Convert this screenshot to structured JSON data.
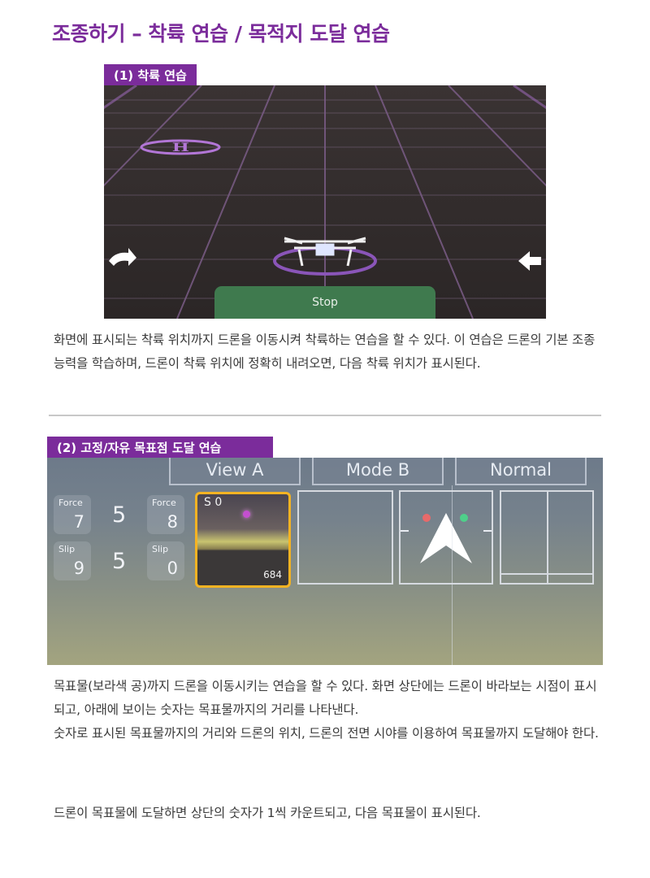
{
  "page": {
    "title": "조종하기 – 착륙 연습 / 목적지 도달 연습"
  },
  "section1": {
    "label": "(1) 착륙 연습",
    "screenshot": {
      "stop_label": "Stop",
      "icons": [
        "helipad-icon",
        "drone-icon",
        "landing-target-icon",
        "rotate-icon",
        "arrow-left-icon"
      ]
    },
    "description": "화면에 표시되는 착륙 위치까지 드론을 이동시켜 착륙하는 연습을 할 수 있다. 이 연습은 드론의 기본 조종 능력을 학습하며, 드론이 착륙 위치에 정확히 내려오면, 다음 착륙 위치가 표시된다."
  },
  "section2": {
    "label": "(2) 고정/자유 목표점 도달 연습",
    "screenshot": {
      "tabs": [
        "View A",
        "Mode B",
        "Normal"
      ],
      "stats": {
        "force_left_caption": "Force",
        "force_left_value": "7",
        "force_middle": "5",
        "force_right_caption": "Force",
        "force_right_value": "8",
        "slip_left_caption": "Slip",
        "slip_left_value": "9",
        "slip_middle": "5",
        "slip_right_caption": "Slip",
        "slip_right_value": "0"
      },
      "camera": {
        "label": "S 0",
        "distance": "684"
      },
      "icons": [
        "target-ball-icon",
        "direction-arrow-icon"
      ]
    },
    "description_1": "목표물(보라색 공)까지 드론을 이동시키는 연습을 할 수 있다. 화면 상단에는 드론이 바라보는 시점이 표시되고, 아래에 보이는 숫자는 목표물까지의 거리를 나타낸다.",
    "description_2": "숫자로 표시된 목표물까지의 거리와 드론의 위치, 드론의 전면 시야를 이용하여 목표물까지 도달해야 한다.",
    "description_3": "드론이 목표물에 도달하면 상단의 숫자가 1씩 카운트되고, 다음 목표물이 표시된다."
  },
  "colors": {
    "accent": "#7b2c9b",
    "stop_button": "#3f7a4e",
    "camera_border": "#f5b323"
  }
}
